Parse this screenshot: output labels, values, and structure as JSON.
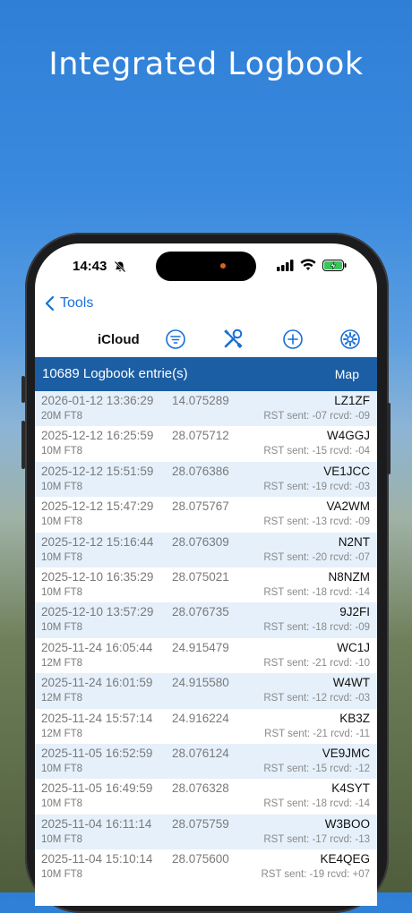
{
  "headline": "Integrated Logbook",
  "status_bar": {
    "time": "14:43"
  },
  "nav": {
    "back_label": "Tools"
  },
  "toolbar": {
    "source_label": "iCloud"
  },
  "list_header": {
    "count_label": "10689 Logbook entrie(s)",
    "map_label": "Map"
  },
  "colors": {
    "accent": "#1a6fd6",
    "header_bg": "#1b5ea3",
    "row_alt": "#e5f0fb",
    "battery": "#35c759",
    "camera_dot": "#d9651c"
  },
  "entries": [
    {
      "datetime": "2026-01-12 13:36:29",
      "freq": "14.075289",
      "call": "LZ1ZF",
      "band_mode": "20M FT8",
      "rst": "RST sent: -07  rcvd: -09"
    },
    {
      "datetime": "2025-12-12 16:25:59",
      "freq": "28.075712",
      "call": "W4GGJ",
      "band_mode": "10M FT8",
      "rst": "RST sent: -15  rcvd: -04"
    },
    {
      "datetime": "2025-12-12 15:51:59",
      "freq": "28.076386",
      "call": "VE1JCC",
      "band_mode": "10M FT8",
      "rst": "RST sent: -19  rcvd: -03"
    },
    {
      "datetime": "2025-12-12 15:47:29",
      "freq": "28.075767",
      "call": "VA2WM",
      "band_mode": "10M FT8",
      "rst": "RST sent: -13  rcvd: -09"
    },
    {
      "datetime": "2025-12-12 15:16:44",
      "freq": "28.076309",
      "call": "N2NT",
      "band_mode": "10M FT8",
      "rst": "RST sent: -20  rcvd: -07"
    },
    {
      "datetime": "2025-12-10 16:35:29",
      "freq": "28.075021",
      "call": "N8NZM",
      "band_mode": "10M FT8",
      "rst": "RST sent: -18  rcvd: -14"
    },
    {
      "datetime": "2025-12-10 13:57:29",
      "freq": "28.076735",
      "call": "9J2FI",
      "band_mode": "10M FT8",
      "rst": "RST sent: -18  rcvd: -09"
    },
    {
      "datetime": "2025-11-24 16:05:44",
      "freq": "24.915479",
      "call": "WC1J",
      "band_mode": "12M FT8",
      "rst": "RST sent: -21  rcvd: -10"
    },
    {
      "datetime": "2025-11-24 16:01:59",
      "freq": "24.915580",
      "call": "W4WT",
      "band_mode": "12M FT8",
      "rst": "RST sent: -12  rcvd: -03"
    },
    {
      "datetime": "2025-11-24 15:57:14",
      "freq": "24.916224",
      "call": "KB3Z",
      "band_mode": "12M FT8",
      "rst": "RST sent: -21  rcvd: -11"
    },
    {
      "datetime": "2025-11-05 16:52:59",
      "freq": "28.076124",
      "call": "VE9JMC",
      "band_mode": "10M FT8",
      "rst": "RST sent: -15  rcvd: -12"
    },
    {
      "datetime": "2025-11-05 16:49:59",
      "freq": "28.076328",
      "call": "K4SYT",
      "band_mode": "10M FT8",
      "rst": "RST sent: -18  rcvd: -14"
    },
    {
      "datetime": "2025-11-04 16:11:14",
      "freq": "28.075759",
      "call": "W3BOO",
      "band_mode": "10M FT8",
      "rst": "RST sent: -17  rcvd: -13"
    },
    {
      "datetime": "2025-11-04 15:10:14",
      "freq": "28.075600",
      "call": "KE4QEG",
      "band_mode": "10M FT8",
      "rst": "RST sent: -19  rcvd: +07"
    }
  ]
}
